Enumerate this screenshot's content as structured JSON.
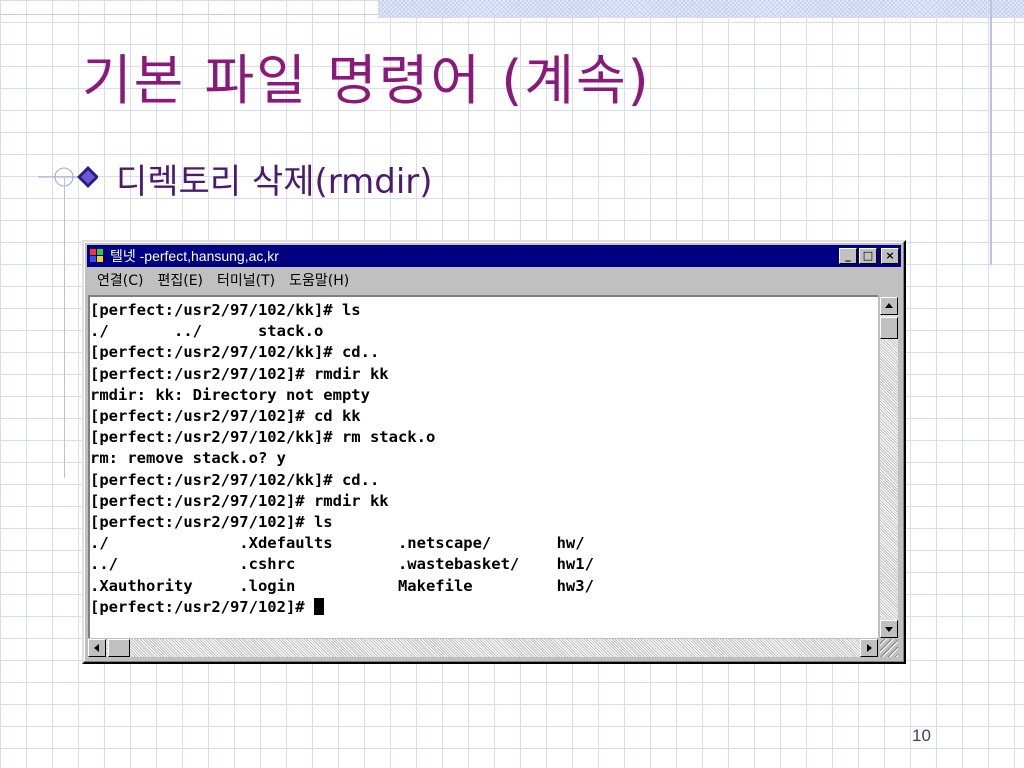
{
  "slide": {
    "title": "기본 파일 명령어 (계속)",
    "bullet": "디렉토리 삭제(rmdir)",
    "page_number": "10"
  },
  "window": {
    "title": "텔넷 -perfect,hansung,ac,kr",
    "menu": [
      "연결(C)",
      "편집(E)",
      "터미널(T)",
      "도움말(H)"
    ],
    "minimize_glyph": "_",
    "maximize_glyph": "□",
    "close_glyph": "×"
  },
  "console": {
    "lines": [
      "[perfect:/usr2/97/102/kk]# ls",
      "./       ../      stack.o",
      "[perfect:/usr2/97/102/kk]# cd..",
      "[perfect:/usr2/97/102]# rmdir kk",
      "rmdir: kk: Directory not empty",
      "[perfect:/usr2/97/102]# cd kk",
      "[perfect:/usr2/97/102/kk]# rm stack.o",
      "rm: remove stack.o? y",
      "[perfect:/usr2/97/102/kk]# cd..",
      "[perfect:/usr2/97/102]# rmdir kk",
      "[perfect:/usr2/97/102]# ls",
      "./              .Xdefaults       .netscape/       hw/",
      "../             .cshrc           .wastebasket/    hw1/",
      ".Xauthority     .login           Makefile         hw3/",
      "[perfect:/usr2/97/102]# "
    ]
  },
  "icons": {
    "bullet": "diamond-bullet-icon",
    "app": "telnet-app-icon"
  },
  "colors": {
    "title": "#8a1a7a",
    "bullet_text": "#4b1a6b",
    "titlebar": "#000080",
    "window_face": "#c0c0c0"
  }
}
